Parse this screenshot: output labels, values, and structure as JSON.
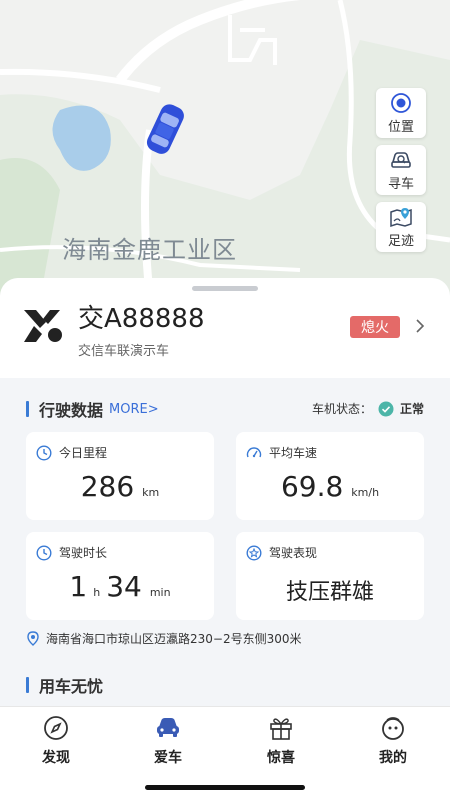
{
  "map": {
    "region_label": "海南金鹿工业区",
    "controls": [
      {
        "label": "位置",
        "icon": "locate-icon"
      },
      {
        "label": "寻车",
        "icon": "find-car-icon"
      },
      {
        "label": "足迹",
        "icon": "footprint-icon"
      }
    ]
  },
  "vehicle": {
    "plate": "交A88888",
    "name": "交信车联演示车",
    "engine_badge": "熄火",
    "badge_color": "#e46a68"
  },
  "driving_data": {
    "title": "行驶数据",
    "more": "MORE>",
    "status_label": "车机状态：",
    "status_value": "正常",
    "today_mileage": {
      "label": "今日里程",
      "value": "286",
      "unit": "km"
    },
    "avg_speed": {
      "label": "平均车速",
      "value": "69.8",
      "unit": "km/h"
    },
    "duration": {
      "label": "驾驶时长",
      "hours": "1",
      "hours_unit": "h",
      "minutes": "34",
      "minutes_unit": "min"
    },
    "performance": {
      "label": "驾驶表现",
      "value": "技压群雄"
    },
    "address": "海南省海口市琼山区迈瀛路230−2号东侧300米"
  },
  "car_care": {
    "title": "用车无忧"
  },
  "tabs": [
    {
      "label": "发现",
      "icon": "compass-icon"
    },
    {
      "label": "爱车",
      "icon": "car-icon",
      "active": true
    },
    {
      "label": "惊喜",
      "icon": "gift-icon"
    },
    {
      "label": "我的",
      "icon": "profile-icon"
    }
  ],
  "colors": {
    "accent": "#3a7bd5",
    "link": "#3a6fd8",
    "status_ok": "#4cb5a8"
  }
}
